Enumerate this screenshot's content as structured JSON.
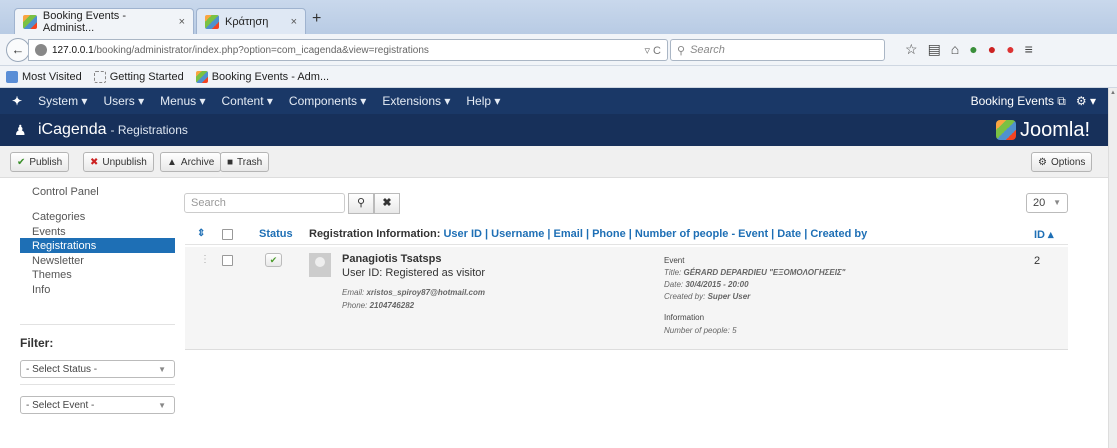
{
  "browser": {
    "tabs": [
      {
        "title": "Booking Events - Administ...",
        "close": "×"
      },
      {
        "title": "Κράτηση",
        "close": "×"
      }
    ],
    "new_tab": "+",
    "url_host": "127.0.0.1",
    "url_path": "/booking/administrator/index.php?option=com_icagenda&view=registrations",
    "search_placeholder": "Search",
    "bookmarks": [
      "Most Visited",
      "Getting Started",
      "Booking Events - Adm..."
    ]
  },
  "joomla_nav": {
    "items": [
      "System ▾",
      "Users ▾",
      "Menus ▾",
      "Content ▾",
      "Components ▾",
      "Extensions ▾",
      "Help ▾"
    ],
    "site_link": "Booking Events ⧉",
    "settings": "⚙ ▾"
  },
  "header": {
    "title": "iCagenda",
    "subtitle": "- Registrations",
    "brand": "Joomla!"
  },
  "toolbar": {
    "publish": "Publish",
    "unpublish": "Unpublish",
    "archive": "Archive",
    "trash": "Trash",
    "options": "Options"
  },
  "sidebar": {
    "items": [
      "Control Panel",
      "Categories",
      "Events",
      "Registrations",
      "Newsletter",
      "Themes",
      "Info"
    ],
    "active": "Registrations",
    "filter_title": "Filter:",
    "status_select": "- Select Status -",
    "event_select": "- Select Event -"
  },
  "search": {
    "placeholder": "Search",
    "limit": "20"
  },
  "table": {
    "col_status": "Status",
    "col_info_prefix": "Registration Information: ",
    "col_info_links": "User ID | Username | Email | Phone | Number of people - Event | Date | Created by",
    "col_id": "ID ▴",
    "rows": [
      {
        "name": "Panagiotis Tsatsps",
        "user_id": "User ID: Registered as visitor",
        "email_label": "Email:",
        "email": "xristos_spiroy87@hotmail.com",
        "phone_label": "Phone:",
        "phone": "2104746282",
        "event_heading": "Event",
        "title_label": "Title:",
        "title": "GÉRARD DEPARDIEU \"ΕΞΟΜΟΛΟΓΗΣΕΙΣ\"",
        "date_label": "Date:",
        "date": "30/4/2015 - 20:00",
        "created_label": "Created by:",
        "created_by": "Super User",
        "info_heading": "Information",
        "people_label": "Number of people:",
        "people": "5",
        "id": "2"
      }
    ]
  },
  "colors": {
    "nav_bg": "#1a3867",
    "header_bg": "#17305a",
    "active_item": "#1e6fb5",
    "link": "#1e6fb5"
  }
}
